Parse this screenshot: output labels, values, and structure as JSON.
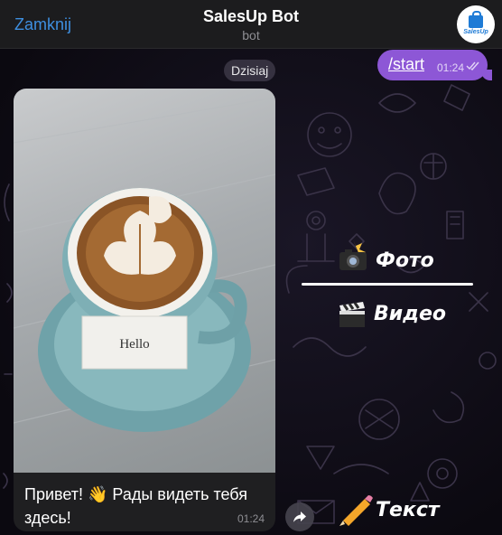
{
  "header": {
    "back_label": "Zamknij",
    "title": "SalesUp Bot",
    "subtitle": "bot",
    "avatar_text": "SalesUp",
    "avatar_icon": "shopping-bag-icon"
  },
  "chat": {
    "date_label": "Dzisiaj",
    "outgoing": {
      "text": "/start",
      "time": "01:24",
      "status_icon": "double-check-icon"
    },
    "incoming": {
      "image_label": "Hello",
      "image_icon": "coffee-cup-photo",
      "caption": "Привет! 👋 Рады видеть тебя здесь!",
      "time": "01:24",
      "share_icon": "share-arrow-icon"
    }
  },
  "overlay": {
    "photo_label": "Фото",
    "photo_icon": "camera-flash-icon",
    "video_label": "Видео",
    "video_icon": "clapperboard-icon",
    "text_label": "Текст",
    "text_icon": "pencil-icon"
  },
  "colors": {
    "accent": "#3e8fe0",
    "outgoing_bubble": "#8d57d6",
    "incoming_bubble": "#1f1f21",
    "header_bg": "#1c1c1e"
  }
}
